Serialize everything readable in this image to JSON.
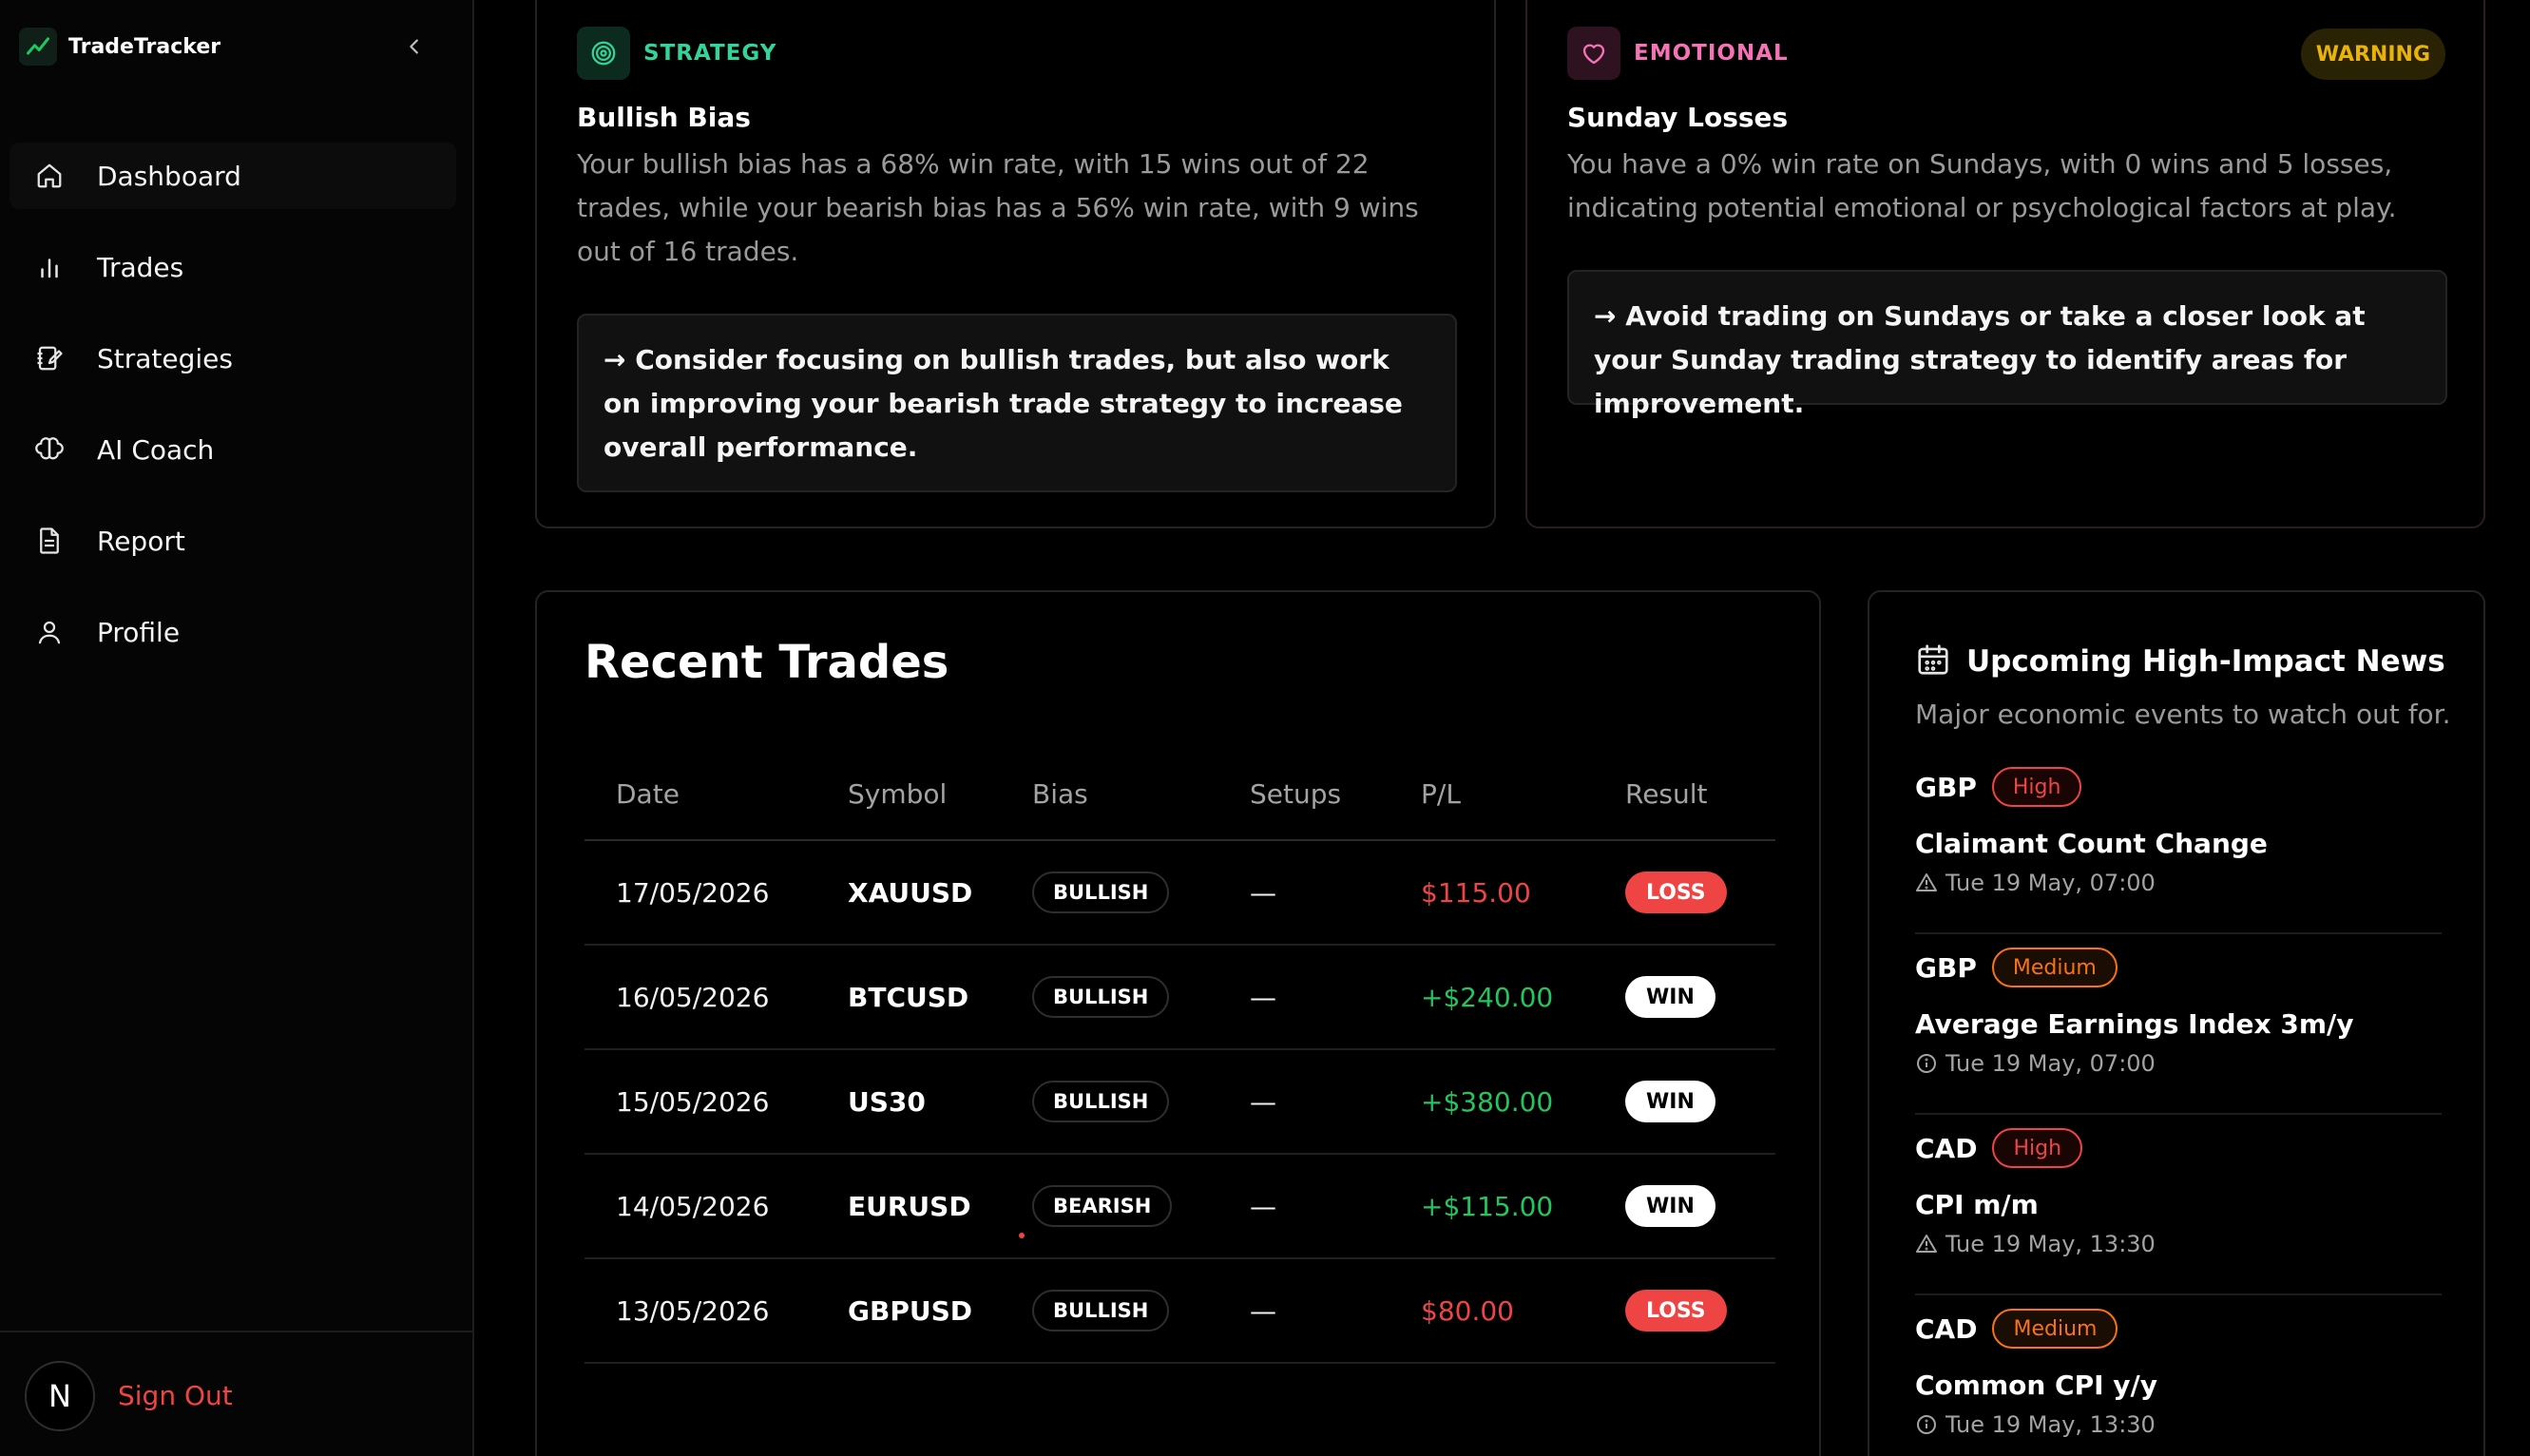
{
  "app": {
    "name": "TradeTracker"
  },
  "sidebar": {
    "items": [
      {
        "label": "Dashboard",
        "icon": "home-icon"
      },
      {
        "label": "Trades",
        "icon": "bar-chart-icon"
      },
      {
        "label": "Strategies",
        "icon": "notebook-pen-icon"
      },
      {
        "label": "AI Coach",
        "icon": "brain-icon"
      },
      {
        "label": "Report",
        "icon": "file-text-icon"
      },
      {
        "label": "Profile",
        "icon": "user-icon"
      }
    ],
    "active": "Dashboard",
    "avatar_letter": "N",
    "sign_out": "Sign Out"
  },
  "insights": [
    {
      "category": "STRATEGY",
      "title": "Bullish Bias",
      "text": "Your bullish bias has a 68% win rate, with 15 wins out of 22 trades, while your bearish bias has a 56% win rate, with 9 wins out of 16 trades.",
      "suggestion": "→ Consider focusing on bullish trades, but also work on improving your bearish trade strategy to increase overall performance."
    },
    {
      "category": "EMOTIONAL",
      "badge": "WARNING",
      "title": "Sunday Losses",
      "text": "You have a 0% win rate on Sundays, with 0 wins and 5 losses, indicating potential emotional or psychological factors at play.",
      "suggestion": "→ Avoid trading on Sundays or take a closer look at your Sunday trading strategy to identify areas for improvement."
    }
  ],
  "trades": {
    "title": "Recent Trades",
    "columns": [
      "Date",
      "Symbol",
      "Bias",
      "Setups",
      "P/L",
      "Result"
    ],
    "rows": [
      {
        "date": "17/05/2026",
        "symbol": "XAUUSD",
        "bias": "BULLISH",
        "setups": "—",
        "pl": "$115.00",
        "result": "LOSS"
      },
      {
        "date": "16/05/2026",
        "symbol": "BTCUSD",
        "bias": "BULLISH",
        "setups": "—",
        "pl": "+$240.00",
        "result": "WIN"
      },
      {
        "date": "15/05/2026",
        "symbol": "US30",
        "bias": "BULLISH",
        "setups": "—",
        "pl": "+$380.00",
        "result": "WIN"
      },
      {
        "date": "14/05/2026",
        "symbol": "EURUSD",
        "bias": "BEARISH",
        "setups": "—",
        "pl": "+$115.00",
        "result": "WIN"
      },
      {
        "date": "13/05/2026",
        "symbol": "GBPUSD",
        "bias": "BULLISH",
        "setups": "—",
        "pl": "$80.00",
        "result": "LOSS"
      }
    ]
  },
  "news": {
    "title": "Upcoming High-Impact News",
    "subtitle": "Major economic events to watch out for.",
    "items": [
      {
        "currency": "GBP",
        "impact": "High",
        "event": "Claimant Count Change",
        "time": "Tue 19 May, 07:00"
      },
      {
        "currency": "GBP",
        "impact": "Medium",
        "event": "Average Earnings Index 3m/y",
        "time": "Tue 19 May, 07:00"
      },
      {
        "currency": "CAD",
        "impact": "High",
        "event": "CPI m/m",
        "time": "Tue 19 May, 13:30"
      },
      {
        "currency": "CAD",
        "impact": "Medium",
        "event": "Common CPI y/y",
        "time": "Tue 19 May, 13:30"
      }
    ]
  },
  "colors": {
    "accent_green": "#22c55e",
    "loss_red": "#ef4444",
    "warning": "#eab308",
    "medium_orange": "#f97316"
  }
}
